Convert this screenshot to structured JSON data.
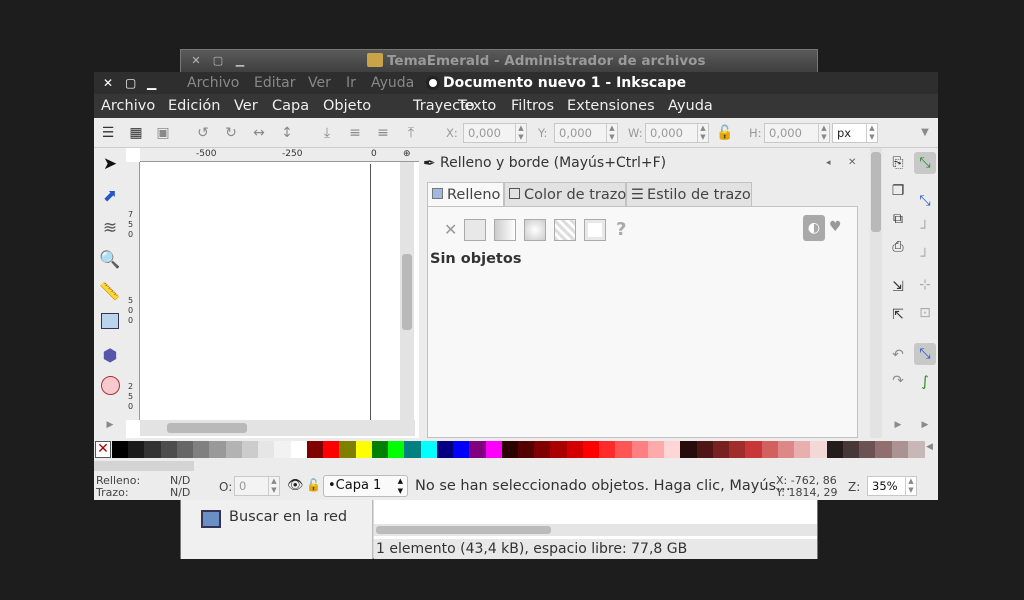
{
  "file_manager": {
    "title": "TemaEmerald - Administrador de archivos",
    "sidebar_item": "Buscar en la red",
    "status": "1 elemento (43,4 kB), espacio libre: 77,8 GB"
  },
  "inkscape": {
    "title": "Documento nuevo 1 - Inkscape",
    "title_menu": [
      "Archivo",
      "Editar",
      "Ver",
      "Ir",
      "Ayuda"
    ],
    "menu": [
      "Archivo",
      "Edición",
      "Ver",
      "Capa",
      "Objeto",
      "Trayecto",
      "Texto",
      "Filtros",
      "Extensiones",
      "Ayuda"
    ],
    "controls": {
      "x_label": "X:",
      "x_value": "0,000",
      "y_label": "Y:",
      "y_value": "0,000",
      "w_label": "W:",
      "w_value": "0,000",
      "h_label": "H:",
      "h_value": "0,000",
      "unit": "px"
    },
    "ruler": {
      "h_ticks": [
        "-500",
        "-250",
        "0"
      ],
      "v_ticks": [
        "7",
        "5",
        "0",
        "5",
        "0",
        "0",
        "2",
        "5",
        "0"
      ]
    },
    "dialog": {
      "title": "Relleno y borde (Mayús+Ctrl+F)",
      "tabs": [
        "Relleno",
        "Color de trazo",
        "Estilo de trazo"
      ],
      "no_objects": "Sin objetos",
      "unknown": "?"
    },
    "status": {
      "fill_label": "Relleno:",
      "fill_value": "N/D",
      "stroke_label": "Trazo:",
      "stroke_value": "N/D",
      "opacity_label": "O:",
      "opacity_value": "0",
      "layer": "•Capa 1",
      "message": "No se han seleccionado objetos. Haga clic, Mayús…",
      "x_coord": "X: -762, 86",
      "y_coord": "Y: 1814, 29",
      "zoom_label": "Z:",
      "zoom_value": "35%"
    },
    "palette": [
      "#000000",
      "#1a1a1a",
      "#333333",
      "#4d4d4d",
      "#666666",
      "#808080",
      "#999999",
      "#b3b3b3",
      "#cccccc",
      "#e6e6e6",
      "#f2f2f2",
      "#ffffff",
      "#800000",
      "#ff0000",
      "#808000",
      "#ffff00",
      "#008000",
      "#00ff00",
      "#008080",
      "#00ffff",
      "#000080",
      "#0000ff",
      "#800080",
      "#ff00ff",
      "#2b0000",
      "#550000",
      "#800000",
      "#aa0000",
      "#d40000",
      "#ff0000",
      "#ff2a2a",
      "#ff5555",
      "#ff8080",
      "#ffaaaa",
      "#ffd5d5",
      "#280b0b",
      "#501616",
      "#782121",
      "#a02c2c",
      "#c83737",
      "#d35f5f",
      "#de8787",
      "#e9afaf",
      "#f4d7d7",
      "#241c1c",
      "#483737",
      "#6c5353",
      "#916f6f",
      "#ac9393",
      "#c8b7b7"
    ]
  }
}
